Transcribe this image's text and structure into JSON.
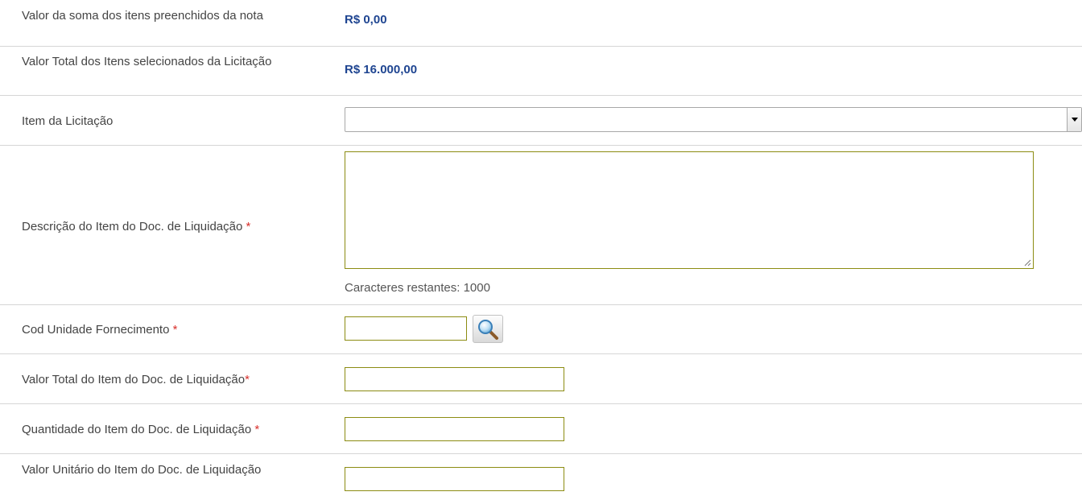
{
  "summary": {
    "sum_label": "Valor da soma dos itens preenchidos da nota",
    "sum_value": "R$ 0,00",
    "total_label": "Valor Total dos Itens selecionados da Licitação",
    "total_value": "R$ 16.000,00"
  },
  "fields": {
    "item_licitacao": {
      "label": "Item da Licitação",
      "value": ""
    },
    "descricao": {
      "label": "Descrição do Item do Doc. de Liquidação",
      "required_mark": "*",
      "value": "",
      "counter_label": "Caracteres restantes:",
      "counter_value": "1000"
    },
    "cod_unidade": {
      "label": "Cod Unidade Fornecimento",
      "required_mark": "*",
      "value": ""
    },
    "valor_total": {
      "label": "Valor Total do Item do Doc. de Liquidação",
      "required_mark": "*",
      "value": ""
    },
    "quantidade": {
      "label": "Quantidade do Item do Doc. de Liquidação",
      "required_mark": "*",
      "value": ""
    },
    "valor_unitario": {
      "label": "Valor Unitário do Item do Doc. de Liquidação",
      "value": ""
    }
  },
  "icons": {
    "lookup": "magnifier-icon",
    "dropdown": "chevron-down-icon",
    "resize": "resize-grip-icon"
  },
  "colors": {
    "money": "#1f4591",
    "required": "#d8302c",
    "input_border": "#8c8c12",
    "separator": "#d6d6d6"
  }
}
